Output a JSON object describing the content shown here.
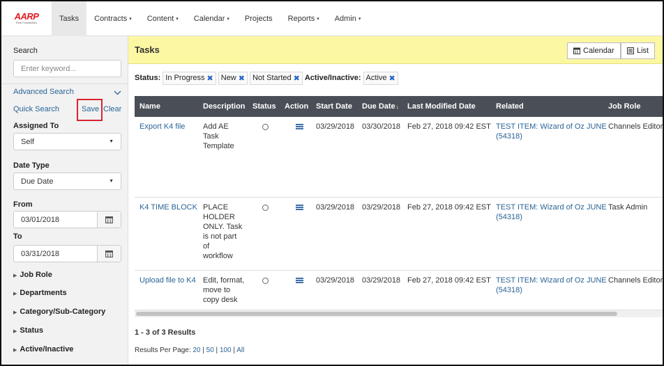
{
  "brand": {
    "logo_text": "AARP",
    "logo_tagline": "Real Possibilities",
    "accent": "#e31b23"
  },
  "nav": [
    {
      "label": "Tasks",
      "dropdown": false,
      "active": true
    },
    {
      "label": "Contracts",
      "dropdown": true
    },
    {
      "label": "Content",
      "dropdown": true
    },
    {
      "label": "Calendar",
      "dropdown": true
    },
    {
      "label": "Projects",
      "dropdown": false
    },
    {
      "label": "Reports",
      "dropdown": true
    },
    {
      "label": "Admin",
      "dropdown": true
    }
  ],
  "sidebar": {
    "search_label": "Search",
    "search_placeholder": "Enter keyword...",
    "advanced_search": "Advanced Search",
    "quick_search": "Quick Search",
    "save": "Save",
    "clear": "Clear",
    "assigned_to_label": "Assigned To",
    "assigned_to_value": "Self",
    "date_type_label": "Date Type",
    "date_type_value": "Due Date",
    "from_label": "From",
    "from_value": "03/01/2018",
    "to_label": "To",
    "to_value": "03/31/2018",
    "collapsibles": [
      "Job Role",
      "Departments",
      "Category/Sub-Category",
      "Status",
      "Active/Inactive"
    ]
  },
  "main": {
    "title": "Tasks",
    "calendar_button": "Calendar",
    "list_button": "List",
    "status_filter_label": "Status:",
    "status_chips": [
      "In Progress",
      "New",
      "Not Started"
    ],
    "active_filter_label": "Active/Inactive:",
    "active_chips": [
      "Active"
    ],
    "columns": [
      "Name",
      "Description",
      "Status",
      "Action",
      "Start Date",
      "Due Date",
      "Last Modified Date",
      "Related",
      "Job Role"
    ],
    "sort_indicator": "↓",
    "rows": [
      {
        "name": "Export K4 file",
        "description": [
          "Add AE",
          "Task",
          "Template"
        ],
        "start": "03/29/2018",
        "due": "03/30/2018",
        "modified": "Feb 27, 2018 09:42 EST",
        "related": [
          "TEST ITEM: Wizard of Oz JUNE",
          "(54318)"
        ],
        "job_role": "Channels Editor"
      },
      {
        "name": "K4 TIME BLOCK",
        "description": [
          "PLACE",
          "HOLDER",
          "ONLY. Task",
          "is not part",
          "of",
          "workflow"
        ],
        "start": "03/29/2018",
        "due": "03/29/2018",
        "modified": "Feb 27, 2018 09:42 EST",
        "related": [
          "TEST ITEM: Wizard of Oz JUNE",
          "(54318)"
        ],
        "job_role": "Task Admin"
      },
      {
        "name": "Upload file to K4",
        "description": [
          "Edit, format,",
          "move to",
          "copy desk"
        ],
        "start": "03/29/2018",
        "due": "03/29/2018",
        "modified": "Feb 27, 2018 09:42 EST",
        "related": [
          "TEST ITEM: Wizard of Oz JUNE",
          "(54318)"
        ],
        "job_role": "Channels Editor"
      }
    ],
    "results_text": "1 - 3 of 3 Results",
    "rpp_label": "Results Per Page:",
    "rpp_options": [
      "20",
      "50",
      "100",
      "All"
    ]
  }
}
